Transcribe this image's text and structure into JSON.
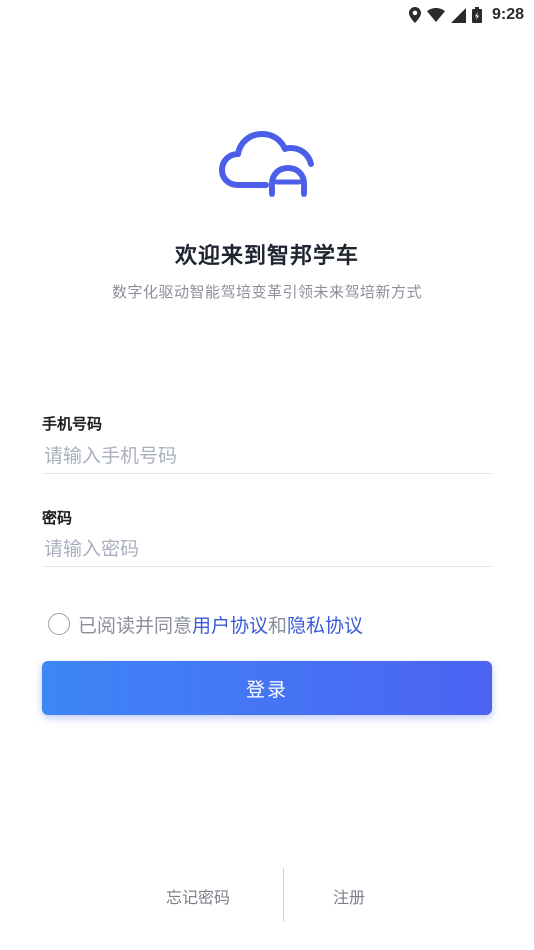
{
  "status_bar": {
    "time": "9:28",
    "icons": [
      "location-icon",
      "wifi-icon",
      "signal-icon",
      "battery-icon"
    ]
  },
  "header": {
    "logo_icon": "cloud-car-icon",
    "title": "欢迎来到智邦学车",
    "subtitle": "数字化驱动智能驾培变革引领未来驾培新方式"
  },
  "form": {
    "phone": {
      "label": "手机号码",
      "placeholder": "请输入手机号码",
      "value": ""
    },
    "password": {
      "label": "密码",
      "placeholder": "请输入密码",
      "value": ""
    }
  },
  "agreement": {
    "checked": false,
    "prefix": "已阅读并同意",
    "user_agreement": "用户协议",
    "and": "和",
    "privacy_policy": "隐私协议"
  },
  "login_button": "登录",
  "footer": {
    "forgot_password": "忘记密码",
    "register": "注册"
  },
  "colors": {
    "accent_start": "#3e86f7",
    "accent_end": "#4c63f2",
    "link": "#3a5bd9",
    "logo": "#4a5ee8"
  }
}
